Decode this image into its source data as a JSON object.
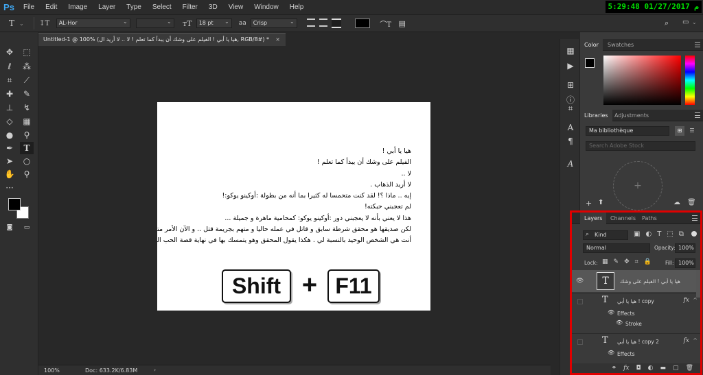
{
  "app": {
    "logo": "Ps"
  },
  "menu": [
    "File",
    "Edit",
    "Image",
    "Layer",
    "Type",
    "Select",
    "Filter",
    "3D",
    "View",
    "Window",
    "Help"
  ],
  "clock": "5:29:48 01/27/2017 م",
  "options_bar": {
    "font_family": "AL-Hor",
    "font_size": "18 pt",
    "anti_alias_label": "aa",
    "anti_alias": "Crisp",
    "text_color": "#000000"
  },
  "document_tab": {
    "title": "Untitled-1 @ 100% (هيا يا أبي ! الفيلم على وشك أن يبدأ كما تعلم ! لا .. لا أريد ال, RGB/8#) *",
    "close": "×"
  },
  "canvas": {
    "lines": [
      "هيا يا أبي !",
      "الفيلم على وشك أن يبدأ كما تعلم !",
      "لا ..",
      "لا أريد الذهاب .",
      "إيه .. ماذا ؟! لقد كنت متحمسا له كثيرا بما أنه من بطولة :أوكينو يوكو:!",
      "لم تعجبني حبكته!",
      "هذا لا يعني بأنه لا يعجبني دور :أوكينو يوكو: كمحامية ماهرة و جميلة ...",
      "لكن صديقها هو محقق شرطة سابق و قاتل في عمله حاليا و متهم بجريمة قتل .. و الآن الأمر متوقف على المحامية",
      "أنت هي الشخص الوحيد بالنسبة لي . هكذا يقول المحقق وهو يتمسك بها في نهاية قصة الحب الحزينة الغامضة"
    ],
    "shortcut": {
      "key1": "Shift",
      "plus": "+",
      "key2": "F11"
    }
  },
  "status": {
    "zoom": "100%",
    "doc": "Doc: 633.2K/6.83M"
  },
  "panels": {
    "color_tabs": [
      "Color",
      "Swatches"
    ],
    "library_tabs": [
      "Libraries",
      "Adjustments"
    ],
    "library_select": "Ma bibliothèque",
    "library_search_placeholder": "Search Adobe Stock",
    "library_add": "+",
    "layers_tabs": [
      "Layers",
      "Channels",
      "Paths"
    ],
    "filter_kind": "Kind",
    "blend_mode": "Normal",
    "opacity_label": "Opacity:",
    "opacity": "100%",
    "lock_label": "Lock:",
    "fill_label": "Fill:",
    "fill": "100%"
  },
  "layers": [
    {
      "name": "هيا يا أبي ! الفيلم على وشك ..."
    },
    {
      "name": "هيا يا أبي ! copy",
      "effects_label": "Effects",
      "effect": "Stroke",
      "fx": "fx"
    },
    {
      "name": "هيا يا أبي ! copy 2",
      "effects_label": "Effects",
      "fx": "fx"
    }
  ],
  "colors": {
    "accent_highlight": "#e00000",
    "clock_text": "#00e000",
    "ps_blue": "#3fa9f5"
  }
}
